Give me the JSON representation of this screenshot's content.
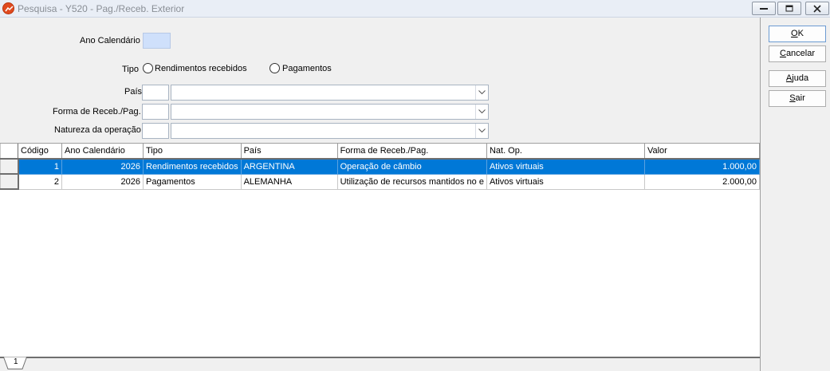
{
  "window": {
    "title": "Pesquisa - Y520 - Pag./Receb. Exterior",
    "icon": "app-logo-icon",
    "controls": [
      "minimize-icon",
      "maximize-icon",
      "close-icon"
    ]
  },
  "form": {
    "ano_label": "Ano Calendário",
    "ano_value": "",
    "tipo_label": "Tipo",
    "tipo_options": [
      "Rendimentos recebidos",
      "Pagamentos"
    ],
    "pais_label": "País",
    "pais_code": "",
    "pais_value": "",
    "forma_label": "Forma de Receb./Pag.",
    "forma_code": "",
    "forma_value": "",
    "natureza_label": "Natureza da operação",
    "natureza_code": "",
    "natureza_value": ""
  },
  "grid": {
    "columns": [
      "Código",
      "Ano Calendário",
      "Tipo",
      "País",
      "Forma de Receb./Pag.",
      "Nat. Op.",
      "Valor"
    ],
    "rows": [
      {
        "codigo": "1",
        "ano": "2026",
        "tipo": "Rendimentos recebidos",
        "pais": "ARGENTINA",
        "forma": "Operação de câmbio",
        "nat": "Ativos virtuais",
        "valor": "1.000,00",
        "selected": true
      },
      {
        "codigo": "2",
        "ano": "2026",
        "tipo": "Pagamentos",
        "pais": "ALEMANHA",
        "forma": "Utilização de recursos mantidos no e",
        "nat": "Ativos virtuais",
        "valor": "2.000,00",
        "selected": false
      }
    ]
  },
  "tabs": {
    "page": "1"
  },
  "buttons": {
    "ok": {
      "pre": "",
      "key": "O",
      "post": "K"
    },
    "cancelar": {
      "pre": "",
      "key": "C",
      "post": "ancelar"
    },
    "ajuda": {
      "pre": "",
      "key": "A",
      "post": "juda"
    },
    "sair": {
      "pre": "",
      "key": "S",
      "post": "air"
    }
  },
  "colors": {
    "selection": "#0078d7",
    "input_highlight": "#cfe0fb",
    "app_icon": "#e04a1f"
  }
}
